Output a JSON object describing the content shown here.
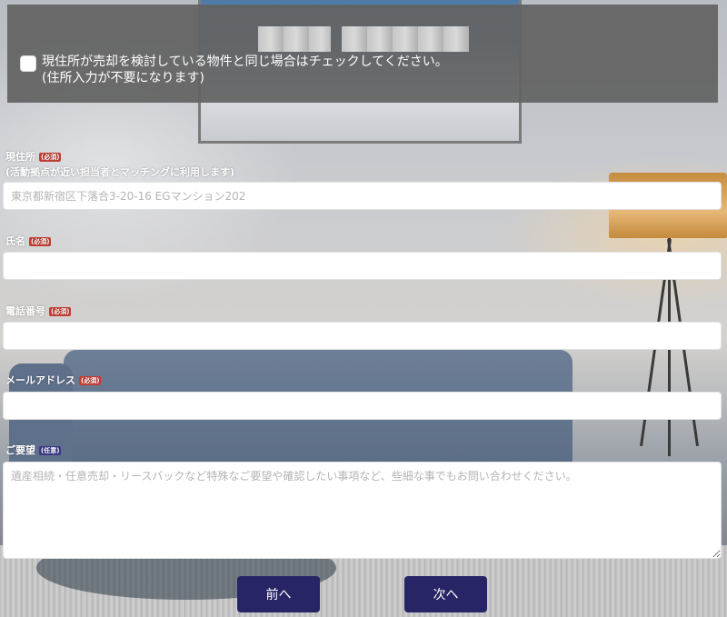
{
  "notice": {
    "checkbox_text_line1": "現住所が売却を検討している物件と同じ場合はチェックしてください。",
    "checkbox_text_line2": "(住所入力が不要になります)"
  },
  "badges": {
    "required": "(必須)",
    "optional": "(任意)"
  },
  "form": {
    "address": {
      "label": "現住所",
      "sublabel": "(活動拠点が近い担当者とマッチングに利用します)",
      "placeholder": "東京都新宿区下落合3-20-16 EGマンション202",
      "value": ""
    },
    "name": {
      "label": "氏名",
      "value": ""
    },
    "phone": {
      "label": "電話番号",
      "value": ""
    },
    "email": {
      "label": "メールアドレス",
      "value": ""
    },
    "request": {
      "label": "ご要望",
      "placeholder": "遺産相続・任意売却・リースバックなど特殊なご要望や確認したい事項など、些細な事でもお問い合わせください。",
      "value": ""
    }
  },
  "buttons": {
    "prev": "前へ",
    "next": "次へ"
  },
  "colors": {
    "button_bg": "#272565",
    "required_badge": "#c53f34",
    "optional_badge": "#3b3a8c",
    "notice_bg": "#626262"
  }
}
